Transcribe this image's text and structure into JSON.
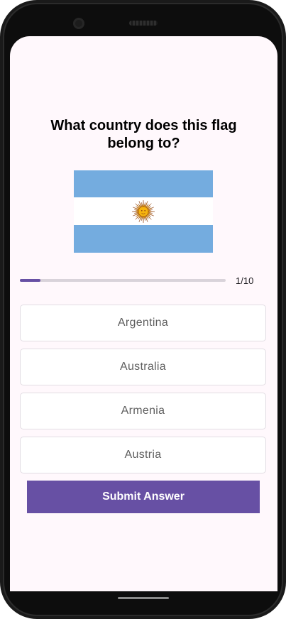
{
  "quiz": {
    "question": "What country does this flag belong to?",
    "flag_icon": "argentina-flag",
    "progress": {
      "label": "1/10",
      "current": 1,
      "total": 10,
      "fraction": 0.1
    },
    "options": [
      {
        "label": "Argentina"
      },
      {
        "label": "Australia"
      },
      {
        "label": "Armenia"
      },
      {
        "label": "Austria"
      }
    ],
    "submit_label": "Submit Answer"
  },
  "colors": {
    "accent": "#6750a4",
    "background": "#fff8fc",
    "flag_blue": "#74acdf",
    "flag_sun": "#f6b40e"
  }
}
